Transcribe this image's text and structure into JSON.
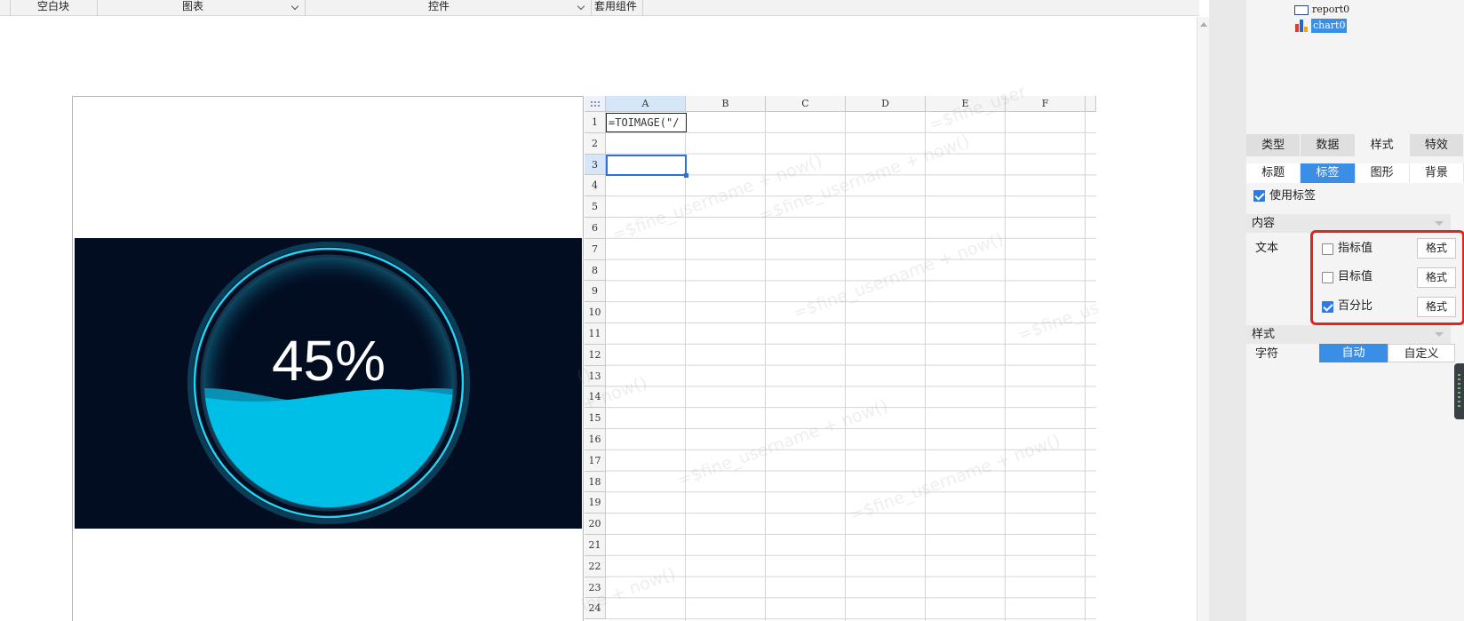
{
  "toolbar": {
    "items": [
      {
        "label": "空白块",
        "has_dropdown": false
      },
      {
        "label": "图表",
        "has_dropdown": true
      },
      {
        "label": "控件",
        "has_dropdown": true
      },
      {
        "label": "套用组件",
        "has_dropdown": false
      }
    ]
  },
  "gauge": {
    "percent": 45,
    "label": "45%",
    "colors": {
      "background": "#020d22",
      "ring": "#1fd4f5",
      "liquid": "#00bfe6",
      "liquid_back": "#0a8fb5",
      "text": "#ffffff"
    }
  },
  "sheet": {
    "columns": [
      "A",
      "B",
      "C",
      "D",
      "E",
      "F"
    ],
    "rows": [
      "1",
      "2",
      "3",
      "4",
      "5",
      "6",
      "7",
      "8",
      "9",
      "10",
      "11",
      "12",
      "13",
      "14",
      "15",
      "16",
      "17",
      "18",
      "19",
      "20",
      "21",
      "22",
      "23",
      "24"
    ],
    "selected_column": "A",
    "selected_row": "3",
    "cell_A1": "=TOIMAGE(\"/",
    "watermarks": [
      "=$fine_username + now()",
      "=$fine_username + now()",
      "=$fine_username + now()",
      "=$fine_username + now()",
      "=$fine_username + now()",
      "=$fine_user",
      "=$fine_us",
      "+ now()",
      "ine + now()",
      "()"
    ]
  },
  "panel": {
    "tree": [
      {
        "label": "report0",
        "icon": "report-icon",
        "highlighted": false
      },
      {
        "label": "chart0",
        "icon": "chart-icon",
        "highlighted": true
      }
    ],
    "tabs": [
      {
        "label": "类型",
        "active": false
      },
      {
        "label": "数据",
        "active": false
      },
      {
        "label": "样式",
        "active": true
      },
      {
        "label": "特效",
        "active": false
      }
    ],
    "subtabs": [
      {
        "label": "标题",
        "active": false
      },
      {
        "label": "标签",
        "active": true
      },
      {
        "label": "图形",
        "active": false
      },
      {
        "label": "背景",
        "active": false
      }
    ],
    "use_label": {
      "label": "使用标签",
      "checked": true
    },
    "content_section": "内容",
    "text_label": "文本",
    "text_options": [
      {
        "label": "指标值",
        "checked": false,
        "format_label": "格式"
      },
      {
        "label": "目标值",
        "checked": false,
        "format_label": "格式"
      },
      {
        "label": "百分比",
        "checked": true,
        "format_label": "格式"
      }
    ],
    "style_section": "样式",
    "char_label": "字符",
    "char_options": [
      {
        "label": "自动",
        "active": true
      },
      {
        "label": "自定义",
        "active": false
      }
    ],
    "highlight_color": "#e3241b",
    "accent_color": "#3a8ee6"
  }
}
